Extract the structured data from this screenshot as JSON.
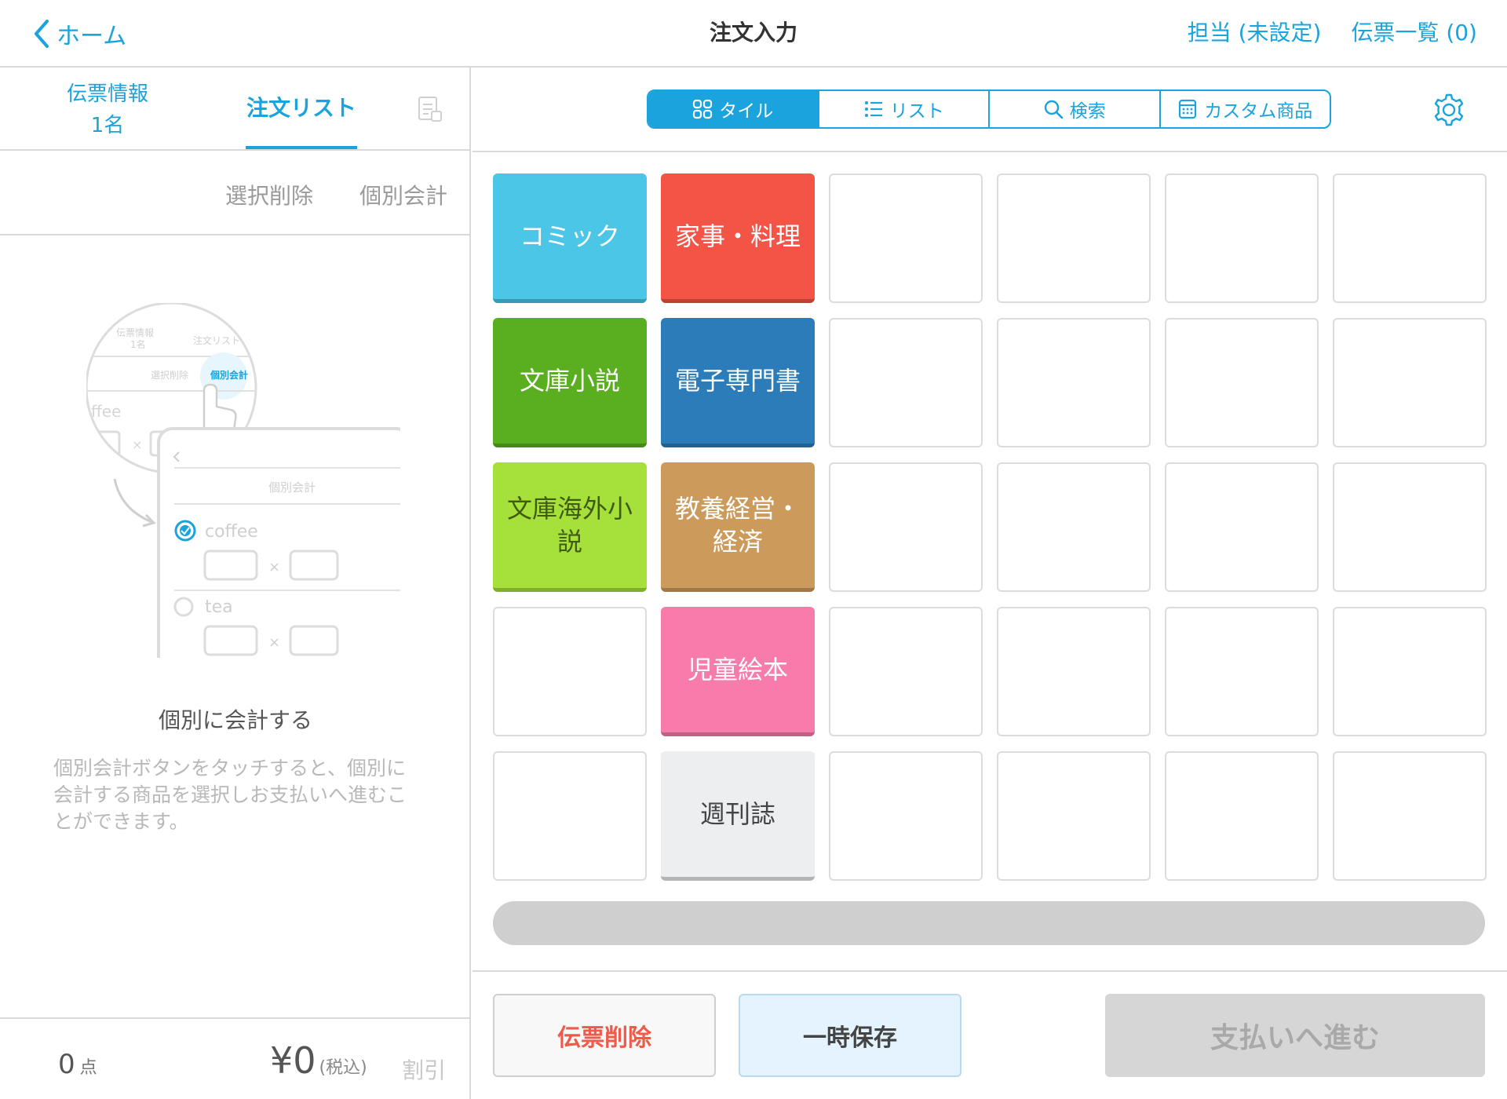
{
  "header": {
    "back_label": "ホーム",
    "title": "注文入力",
    "staff_label": "担当 (未設定)",
    "slips_label": "伝票一覧 (0)"
  },
  "left_panel": {
    "tab_info_line1": "伝票情報",
    "tab_info_line2": "1名",
    "tab_order": "注文リスト",
    "actions": {
      "delete_selected": "選択削除",
      "individual_checkout": "個別会計"
    },
    "illustration": {
      "tab1": "伝票情報",
      "tab1_sub": "1名",
      "tab2": "注文リスト",
      "action1": "選択削除",
      "action2": "個別会計",
      "item1_partial": "ffee",
      "item1": "coffee",
      "item2": "tea",
      "times": "×"
    },
    "help_title": "個別に会計する",
    "help_text": "個別会計ボタンをタッチすると、個別に会計する商品を選択しお支払いへ進むことができます。",
    "footer": {
      "count": "0",
      "count_unit": "点",
      "total": "¥0",
      "tax_note": "(税込)",
      "discount": "割引"
    }
  },
  "toolbar": {
    "view_modes": [
      {
        "label": "タイル",
        "icon": "tile-grid-icon",
        "active": true
      },
      {
        "label": "リスト",
        "icon": "list-icon",
        "active": false
      },
      {
        "label": "検索",
        "icon": "search-icon",
        "active": false
      },
      {
        "label": "カスタム商品",
        "icon": "calculator-icon",
        "active": false
      }
    ]
  },
  "tiles": [
    {
      "label": "コミック",
      "color": "#4bc6e6"
    },
    {
      "label": "家事・料理",
      "color": "#f45446"
    },
    {
      "label": "",
      "color": ""
    },
    {
      "label": "",
      "color": ""
    },
    {
      "label": "",
      "color": ""
    },
    {
      "label": "",
      "color": ""
    },
    {
      "label": "文庫小説",
      "color": "#5aaf20"
    },
    {
      "label": "電子専門書",
      "color": "#2b7cb8"
    },
    {
      "label": "",
      "color": ""
    },
    {
      "label": "",
      "color": ""
    },
    {
      "label": "",
      "color": ""
    },
    {
      "label": "",
      "color": ""
    },
    {
      "label": "文庫海外小説",
      "color": "#a6e03a",
      "light_text": true
    },
    {
      "label": "教養経営・経済",
      "color": "#cc9b5c"
    },
    {
      "label": "",
      "color": ""
    },
    {
      "label": "",
      "color": ""
    },
    {
      "label": "",
      "color": ""
    },
    {
      "label": "",
      "color": ""
    },
    {
      "label": "",
      "color": ""
    },
    {
      "label": "児童絵本",
      "color": "#f77bab"
    },
    {
      "label": "",
      "color": ""
    },
    {
      "label": "",
      "color": ""
    },
    {
      "label": "",
      "color": ""
    },
    {
      "label": "",
      "color": ""
    },
    {
      "label": "",
      "color": ""
    },
    {
      "label": "週刊誌",
      "color": "#eceeef",
      "light_text": true
    },
    {
      "label": "",
      "color": ""
    },
    {
      "label": "",
      "color": ""
    },
    {
      "label": "",
      "color": ""
    },
    {
      "label": "",
      "color": ""
    }
  ],
  "bottom_buttons": {
    "delete_slip": "伝票削除",
    "temp_save": "一時保存",
    "proceed_payment": "支払いへ進む"
  },
  "colors": {
    "accent": "#1aa3dc",
    "danger": "#f05a4a",
    "disabled": "#d6d6d6"
  }
}
